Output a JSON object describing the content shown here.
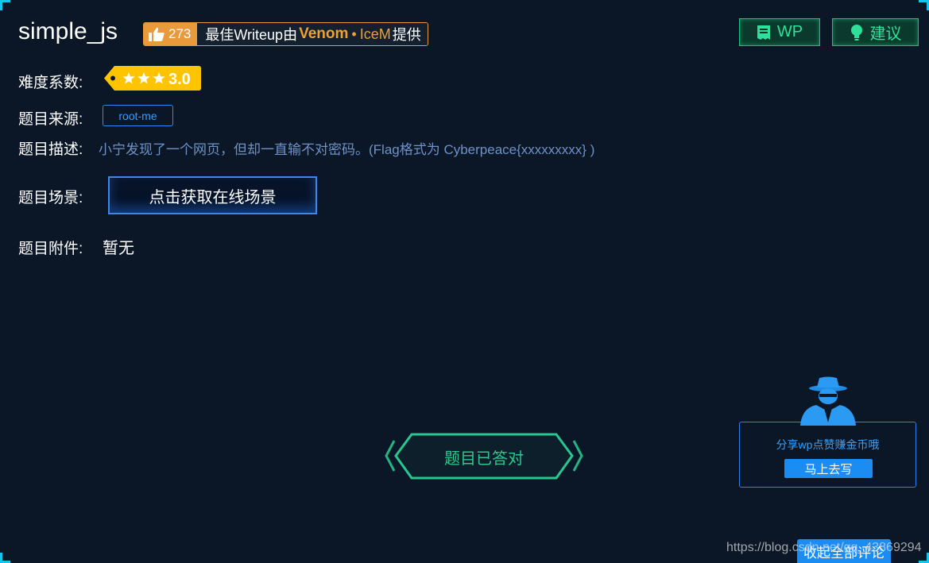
{
  "challenge": {
    "title": "simple_js",
    "likes": "273",
    "best_writeup_prefix": "最佳Writeup由",
    "best_writeup_author1": "Venom",
    "best_writeup_sep": "•",
    "best_writeup_author2": "IceM",
    "best_writeup_suffix": "提供"
  },
  "toolbar": {
    "wp_label": "WP",
    "suggest_label": "建议"
  },
  "fields": {
    "difficulty_label": "难度系数:",
    "difficulty_value": "3.0",
    "difficulty_stars": 3,
    "source_label": "题目来源:",
    "source_value": "root-me",
    "description_label": "题目描述:",
    "description_value": "小宁发现了一个网页，但却一直输不对密码。(Flag格式为 Cyberpeace{xxxxxxxxx} )",
    "scene_label": "题目场景:",
    "scene_button": "点击获取在线场景",
    "attachment_label": "题目附件:",
    "attachment_value": "暂无"
  },
  "status": {
    "solved_label": "题目已答对"
  },
  "promo": {
    "text": "分享wp点赞赚金币哦",
    "button": "马上去写"
  },
  "footer": {
    "collapse_label": "收起全部评论",
    "watermark": "https://blog.csdn.net/qq_43869294"
  },
  "colors": {
    "background": "#0b1626",
    "accent_orange": "#e89a3c",
    "accent_green": "#2fe09a",
    "accent_blue": "#1a8cf2",
    "rating_yellow": "#ffc400"
  }
}
